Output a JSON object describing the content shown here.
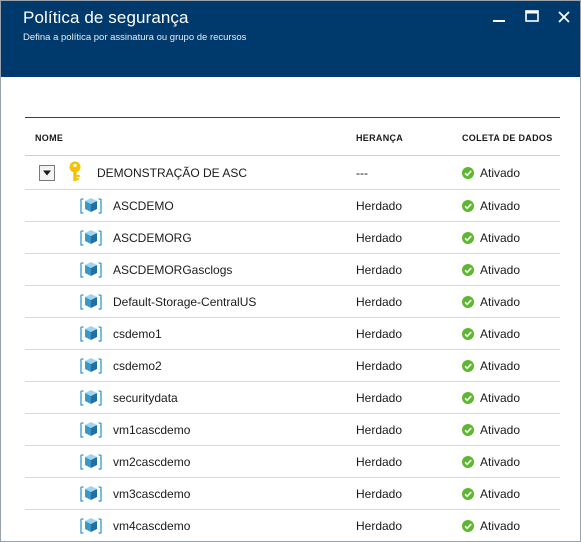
{
  "header": {
    "title": "Política de segurança",
    "subtitle": "Defina a política por assinatura ou grupo de recursos",
    "controls": [
      "pin-icon",
      "maximize-icon",
      "close-icon"
    ]
  },
  "table": {
    "columns": {
      "name": "NOME",
      "inheritance": "HERANÇA",
      "collection": "COLETA DE DADOS"
    },
    "group": {
      "icon": "key-icon",
      "name": "DEMONSTRAÇÃO DE ASC",
      "inheritance": "---",
      "status": "Ativado"
    },
    "rows": [
      {
        "name": "ASCDEMO",
        "inheritance": "Herdado",
        "status": "Ativado"
      },
      {
        "name": "ASCDEMORG",
        "inheritance": "Herdado",
        "status": "Ativado"
      },
      {
        "name": "ASCDEMORGasclogs",
        "inheritance": "Herdado",
        "status": "Ativado"
      },
      {
        "name": "Default-Storage-CentralUS",
        "inheritance": "Herdado",
        "status": "Ativado"
      },
      {
        "name": "csdemo1",
        "inheritance": "Herdado",
        "status": "Ativado"
      },
      {
        "name": "csdemo2",
        "inheritance": "Herdado",
        "status": "Ativado"
      },
      {
        "name": "securitydata",
        "inheritance": "Herdado",
        "status": "Ativado"
      },
      {
        "name": "vm1cascdemo",
        "inheritance": "Herdado",
        "status": "Ativado"
      },
      {
        "name": "vm2cascdemo",
        "inheritance": "Herdado",
        "status": "Ativado"
      },
      {
        "name": "vm3cascdemo",
        "inheritance": "Herdado",
        "status": "Ativado"
      },
      {
        "name": "vm4cascdemo",
        "inheritance": "Herdado",
        "status": "Ativado"
      }
    ]
  },
  "colors": {
    "header_bg": "#003a6c",
    "status_green": "#5cb82e",
    "cube_blue": "#3999c6",
    "key_gold": "#f5c200"
  }
}
